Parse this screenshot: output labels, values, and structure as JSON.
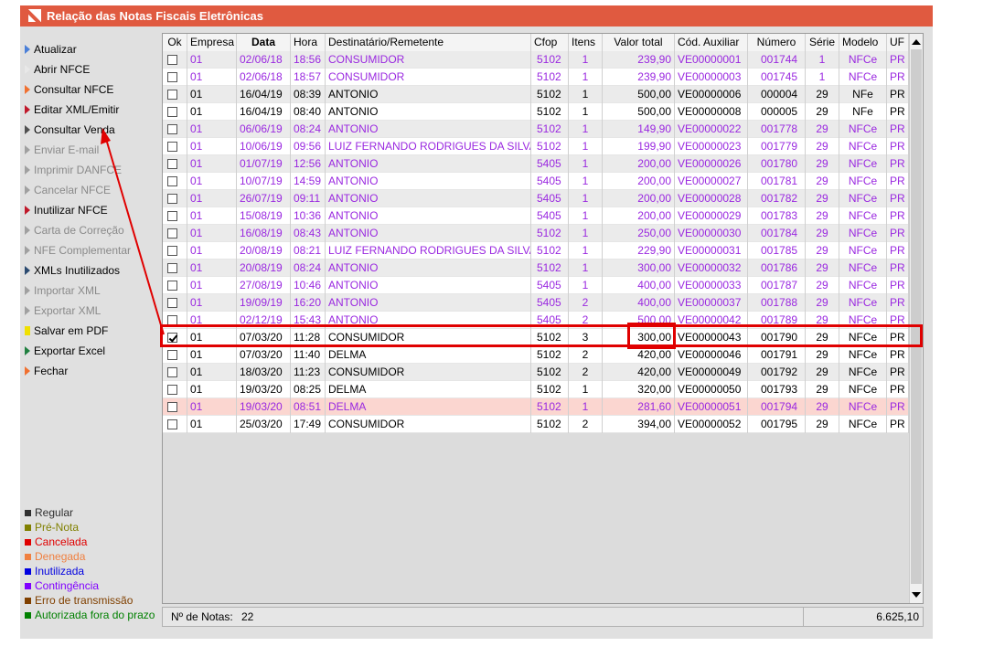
{
  "window": {
    "title": "Relação das Notas Fiscais Eletrônicas"
  },
  "sidebar": {
    "items": [
      {
        "label": "Atualizar",
        "icon": "triangle-icon",
        "color": "#4a7fd8",
        "enabled": true
      },
      {
        "label": "Abrir NFCE",
        "icon": "triangle-icon",
        "color": "#e8e8e8",
        "enabled": true
      },
      {
        "label": "Consultar NFCE",
        "icon": "triangle-icon",
        "color": "#f07030",
        "enabled": true
      },
      {
        "label": "Editar XML/Emitir",
        "icon": "triangle-icon",
        "color": "#c0182a",
        "enabled": true
      },
      {
        "label": "Consultar Venda",
        "icon": "triangle-icon",
        "color": "#505050",
        "enabled": true
      },
      {
        "label": "Enviar E-mail",
        "icon": "triangle-icon",
        "color": "#a0a0a0",
        "enabled": false
      },
      {
        "label": "Imprimir DANFCE",
        "icon": "triangle-icon",
        "color": "#a0a0a0",
        "enabled": false
      },
      {
        "label": "Cancelar NFCE",
        "icon": "triangle-icon",
        "color": "#a0a0a0",
        "enabled": false
      },
      {
        "label": "Inutilizar NFCE",
        "icon": "triangle-icon",
        "color": "#c0182a",
        "enabled": true
      },
      {
        "label": "Carta de Correção",
        "icon": "triangle-icon",
        "color": "#a0a0a0",
        "enabled": false
      },
      {
        "label": "NFE Complementar",
        "icon": "triangle-icon",
        "color": "#a0a0a0",
        "enabled": false
      },
      {
        "label": "XMLs Inutilizados",
        "icon": "triangle-icon",
        "color": "#2a4a70",
        "enabled": true
      },
      {
        "label": "Importar XML",
        "icon": "triangle-icon",
        "color": "#a0a0a0",
        "enabled": false
      },
      {
        "label": "Exportar XML",
        "icon": "triangle-icon",
        "color": "#a0a0a0",
        "enabled": false
      },
      {
        "label": "Salvar em PDF",
        "icon": "square-icon",
        "color": "#f0e000",
        "enabled": true
      },
      {
        "label": "Exportar Excel",
        "icon": "triangle-icon",
        "color": "#208040",
        "enabled": true
      },
      {
        "label": "Fechar",
        "icon": "triangle-icon",
        "color": "#f07030",
        "enabled": true
      }
    ],
    "legend": [
      {
        "label": "Regular",
        "color": "#303030"
      },
      {
        "label": "Pré-Nota",
        "color": "#808000"
      },
      {
        "label": "Cancelada",
        "color": "#e00000"
      },
      {
        "label": "Denegada",
        "color": "#f08040"
      },
      {
        "label": "Inutilizada",
        "color": "#0000e0"
      },
      {
        "label": "Contingência",
        "color": "#8000ff"
      },
      {
        "label": "Erro de transmissão",
        "color": "#804000"
      },
      {
        "label": "Autorizada fora do prazo",
        "color": "#008000"
      }
    ]
  },
  "table": {
    "columns": [
      "Ok",
      "Empresa",
      "Data",
      "Hora",
      "Destinatário/Remetente",
      "Cfop",
      "Itens",
      "Valor total",
      "Cód. Auxiliar",
      "Número",
      "Série",
      "Modelo",
      "UF"
    ],
    "rows": [
      {
        "ok": false,
        "empresa": "01",
        "data": "02/06/18",
        "hora": "18:56",
        "dest": "CONSUMIDOR",
        "cfop": "5102",
        "itens": "1",
        "valor": "239,90",
        "aux": "VE00000001",
        "numero": "001744",
        "serie": "1",
        "modelo": "NFCe",
        "uf": "PR",
        "status": "contingencia"
      },
      {
        "ok": false,
        "empresa": "01",
        "data": "02/06/18",
        "hora": "18:57",
        "dest": "CONSUMIDOR",
        "cfop": "5102",
        "itens": "1",
        "valor": "239,90",
        "aux": "VE00000003",
        "numero": "001745",
        "serie": "1",
        "modelo": "NFCe",
        "uf": "PR",
        "status": "contingencia"
      },
      {
        "ok": false,
        "empresa": "01",
        "data": "16/04/19",
        "hora": "08:39",
        "dest": "ANTONIO",
        "cfop": "5102",
        "itens": "1",
        "valor": "500,00",
        "aux": "VE00000006",
        "numero": "000004",
        "serie": "29",
        "modelo": "NFe",
        "uf": "PR",
        "status": "regular"
      },
      {
        "ok": false,
        "empresa": "01",
        "data": "16/04/19",
        "hora": "08:40",
        "dest": "ANTONIO",
        "cfop": "5102",
        "itens": "1",
        "valor": "500,00",
        "aux": "VE00000008",
        "numero": "000005",
        "serie": "29",
        "modelo": "NFe",
        "uf": "PR",
        "status": "regular"
      },
      {
        "ok": false,
        "empresa": "01",
        "data": "06/06/19",
        "hora": "08:24",
        "dest": "ANTONIO",
        "cfop": "5102",
        "itens": "1",
        "valor": "149,90",
        "aux": "VE00000022",
        "numero": "001778",
        "serie": "29",
        "modelo": "NFCe",
        "uf": "PR",
        "status": "contingencia"
      },
      {
        "ok": false,
        "empresa": "01",
        "data": "10/06/19",
        "hora": "09:56",
        "dest": "LUIZ FERNANDO RODRIGUES DA SILVA",
        "cfop": "5102",
        "itens": "1",
        "valor": "199,90",
        "aux": "VE00000023",
        "numero": "001779",
        "serie": "29",
        "modelo": "NFCe",
        "uf": "PR",
        "status": "contingencia"
      },
      {
        "ok": false,
        "empresa": "01",
        "data": "01/07/19",
        "hora": "12:56",
        "dest": "ANTONIO",
        "cfop": "5405",
        "itens": "1",
        "valor": "200,00",
        "aux": "VE00000026",
        "numero": "001780",
        "serie": "29",
        "modelo": "NFCe",
        "uf": "PR",
        "status": "contingencia"
      },
      {
        "ok": false,
        "empresa": "01",
        "data": "10/07/19",
        "hora": "14:59",
        "dest": "ANTONIO",
        "cfop": "5405",
        "itens": "1",
        "valor": "200,00",
        "aux": "VE00000027",
        "numero": "001781",
        "serie": "29",
        "modelo": "NFCe",
        "uf": "PR",
        "status": "contingencia"
      },
      {
        "ok": false,
        "empresa": "01",
        "data": "26/07/19",
        "hora": "09:11",
        "dest": "ANTONIO",
        "cfop": "5405",
        "itens": "1",
        "valor": "200,00",
        "aux": "VE00000028",
        "numero": "001782",
        "serie": "29",
        "modelo": "NFCe",
        "uf": "PR",
        "status": "contingencia"
      },
      {
        "ok": false,
        "empresa": "01",
        "data": "15/08/19",
        "hora": "10:36",
        "dest": "ANTONIO",
        "cfop": "5405",
        "itens": "1",
        "valor": "200,00",
        "aux": "VE00000029",
        "numero": "001783",
        "serie": "29",
        "modelo": "NFCe",
        "uf": "PR",
        "status": "contingencia"
      },
      {
        "ok": false,
        "empresa": "01",
        "data": "16/08/19",
        "hora": "08:43",
        "dest": "ANTONIO",
        "cfop": "5102",
        "itens": "1",
        "valor": "250,00",
        "aux": "VE00000030",
        "numero": "001784",
        "serie": "29",
        "modelo": "NFCe",
        "uf": "PR",
        "status": "contingencia"
      },
      {
        "ok": false,
        "empresa": "01",
        "data": "20/08/19",
        "hora": "08:21",
        "dest": "LUIZ FERNANDO RODRIGUES DA SILVA",
        "cfop": "5102",
        "itens": "1",
        "valor": "229,90",
        "aux": "VE00000031",
        "numero": "001785",
        "serie": "29",
        "modelo": "NFCe",
        "uf": "PR",
        "status": "contingencia"
      },
      {
        "ok": false,
        "empresa": "01",
        "data": "20/08/19",
        "hora": "08:24",
        "dest": "ANTONIO",
        "cfop": "5102",
        "itens": "1",
        "valor": "300,00",
        "aux": "VE00000032",
        "numero": "001786",
        "serie": "29",
        "modelo": "NFCe",
        "uf": "PR",
        "status": "contingencia"
      },
      {
        "ok": false,
        "empresa": "01",
        "data": "27/08/19",
        "hora": "10:46",
        "dest": "ANTONIO",
        "cfop": "5405",
        "itens": "1",
        "valor": "400,00",
        "aux": "VE00000033",
        "numero": "001787",
        "serie": "29",
        "modelo": "NFCe",
        "uf": "PR",
        "status": "contingencia"
      },
      {
        "ok": false,
        "empresa": "01",
        "data": "19/09/19",
        "hora": "16:20",
        "dest": "ANTONIO",
        "cfop": "5405",
        "itens": "2",
        "valor": "400,00",
        "aux": "VE00000037",
        "numero": "001788",
        "serie": "29",
        "modelo": "NFCe",
        "uf": "PR",
        "status": "contingencia"
      },
      {
        "ok": false,
        "empresa": "01",
        "data": "02/12/19",
        "hora": "15:43",
        "dest": "ANTONIO",
        "cfop": "5405",
        "itens": "2",
        "valor": "500,00",
        "aux": "VE00000042",
        "numero": "001789",
        "serie": "29",
        "modelo": "NFCe",
        "uf": "PR",
        "status": "contingencia"
      },
      {
        "ok": true,
        "empresa": "01",
        "data": "07/03/20",
        "hora": "11:28",
        "dest": "CONSUMIDOR",
        "cfop": "5102",
        "itens": "3",
        "valor": "300,00",
        "aux": "VE00000043",
        "numero": "001790",
        "serie": "29",
        "modelo": "NFCe",
        "uf": "PR",
        "status": "regular"
      },
      {
        "ok": false,
        "empresa": "01",
        "data": "07/03/20",
        "hora": "11:40",
        "dest": "DELMA",
        "cfop": "5102",
        "itens": "2",
        "valor": "420,00",
        "aux": "VE00000046",
        "numero": "001791",
        "serie": "29",
        "modelo": "NFCe",
        "uf": "PR",
        "status": "regular"
      },
      {
        "ok": false,
        "empresa": "01",
        "data": "18/03/20",
        "hora": "11:23",
        "dest": "CONSUMIDOR",
        "cfop": "5102",
        "itens": "2",
        "valor": "420,00",
        "aux": "VE00000049",
        "numero": "001792",
        "serie": "29",
        "modelo": "NFCe",
        "uf": "PR",
        "status": "regular"
      },
      {
        "ok": false,
        "empresa": "01",
        "data": "19/03/20",
        "hora": "08:25",
        "dest": "DELMA",
        "cfop": "5102",
        "itens": "1",
        "valor": "320,00",
        "aux": "VE00000050",
        "numero": "001793",
        "serie": "29",
        "modelo": "NFCe",
        "uf": "PR",
        "status": "regular"
      },
      {
        "ok": false,
        "empresa": "01",
        "data": "19/03/20",
        "hora": "08:51",
        "dest": "DELMA",
        "cfop": "5102",
        "itens": "1",
        "valor": "281,60",
        "aux": "VE00000051",
        "numero": "001794",
        "serie": "29",
        "modelo": "NFCe",
        "uf": "PR",
        "status": "contingencia-pink"
      },
      {
        "ok": false,
        "empresa": "01",
        "data": "25/03/20",
        "hora": "17:49",
        "dest": "CONSUMIDOR",
        "cfop": "5102",
        "itens": "2",
        "valor": "394,00",
        "aux": "VE00000052",
        "numero": "001795",
        "serie": "29",
        "modelo": "NFCe",
        "uf": "PR",
        "status": "regular"
      }
    ]
  },
  "footer": {
    "count_label": "Nº de Notas:",
    "count_value": "22",
    "total_value": "6.625,10"
  },
  "colors": {
    "titlebar": "#e05a40",
    "contingencia_text": "#9a28e0",
    "regular_text": "#000000",
    "highlight": "#e00000"
  }
}
